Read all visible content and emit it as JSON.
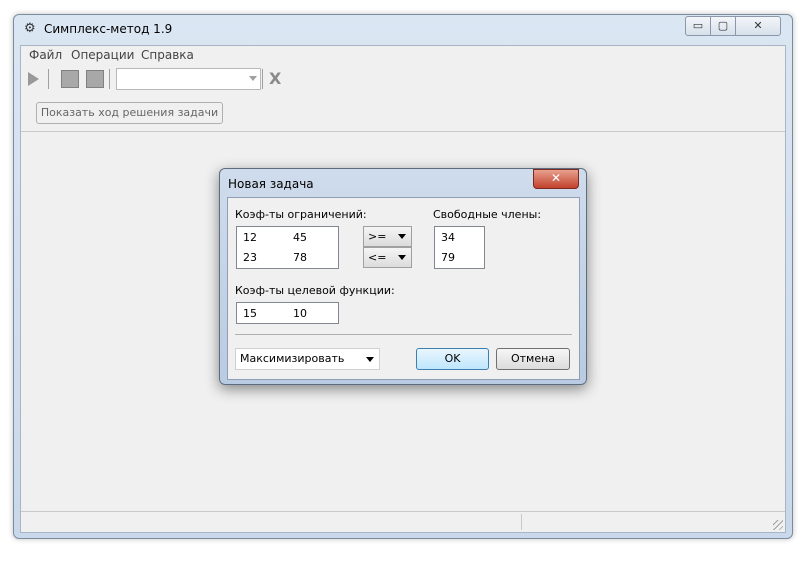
{
  "window": {
    "title": "Симплекс-метод 1.9",
    "controls": {
      "minimize": "▭",
      "maximize": "▢",
      "close": "✕"
    }
  },
  "menu": {
    "items": [
      "Файл",
      "Операции",
      "Справка"
    ]
  },
  "toolbar": {
    "combo_value": ""
  },
  "panel": {
    "show_solution_label": "Показать ход решения задачи"
  },
  "dialog": {
    "title": "Новая задача",
    "close_label": "✕",
    "constraints_label": "Коэф-ты ограничений:",
    "free_terms_label": "Свободные члены:",
    "constraints": [
      [
        "12",
        "45"
      ],
      [
        "23",
        "78"
      ]
    ],
    "signs": [
      ">=",
      "<="
    ],
    "free_terms": [
      "34",
      "79"
    ],
    "objective_label": "Коэф-ты целевой функции:",
    "objective": [
      "15",
      "10"
    ],
    "mode_value": "Максимизировать",
    "ok_label": "OK",
    "cancel_label": "Отмена"
  },
  "colors": {
    "titlebar": "#dbe6f3",
    "client": "#f0f0f0",
    "close_button": "#c2412c"
  }
}
